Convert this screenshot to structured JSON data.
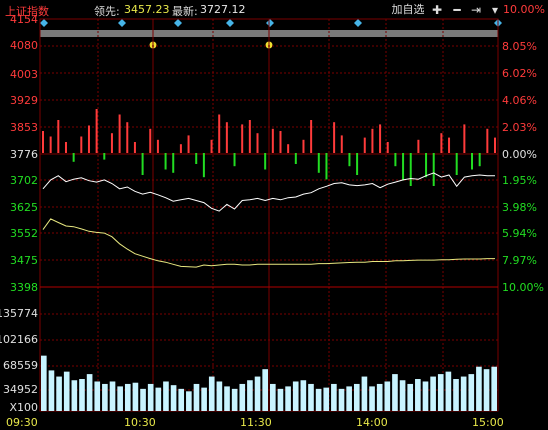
{
  "header": {
    "index_name": "上证指数",
    "lead_label": "领先:",
    "lead_value": "3457.23",
    "latest_label": "最新:",
    "latest_value": "3727.12",
    "select_label": "加自选",
    "zoom_in_icon": "plus-icon",
    "zoom_out_icon": "minus-icon",
    "last_icon": "skip-to-end-icon",
    "menu_icon": "dropdown-arrow-icon"
  },
  "price_axis": {
    "left": [
      "4154",
      "4080",
      "4003",
      "3929",
      "3853",
      "3776",
      "3702",
      "3625",
      "3552",
      "3475",
      "3398"
    ],
    "right": [
      "10.00%",
      "8.05%",
      "6.02%",
      "4.06%",
      "2.03%",
      "0.00%",
      "1.95%",
      "3.98%",
      "5.94%",
      "7.97%",
      "10.00%"
    ]
  },
  "volume_axis": [
    "135774",
    "102166",
    "68559",
    "34952",
    "X100"
  ],
  "time_axis": [
    "09:30",
    "10:30",
    "11:30",
    "14:00",
    "15:00"
  ],
  "colors": {
    "up": "#ff3b3b",
    "down": "#22dd22",
    "price_line": "#ffffff",
    "avg_line": "#e8e880",
    "grid": "#7a0000",
    "volume": "#c8f4ff"
  },
  "chart_data": {
    "type": "line",
    "y_range": [
      3398,
      4154
    ],
    "base_value": 3776,
    "price_series": [
      3675,
      3700,
      3712,
      3695,
      3702,
      3706,
      3698,
      3694,
      3700,
      3690,
      3675,
      3680,
      3668,
      3660,
      3665,
      3658,
      3650,
      3640,
      3644,
      3648,
      3642,
      3636,
      3620,
      3612,
      3631,
      3618,
      3642,
      3644,
      3648,
      3642,
      3648,
      3644,
      3650,
      3652,
      3660,
      3664,
      3675,
      3682,
      3690,
      3692,
      3686,
      3684,
      3686,
      3690,
      3678,
      3688,
      3694,
      3700,
      3704,
      3702,
      3712,
      3720,
      3708,
      3714,
      3682,
      3708,
      3712,
      3714,
      3712,
      3712
    ],
    "avg_series": [
      3560,
      3590,
      3580,
      3570,
      3568,
      3562,
      3555,
      3552,
      3550,
      3540,
      3520,
      3505,
      3492,
      3485,
      3478,
      3472,
      3468,
      3462,
      3456,
      3455,
      3454,
      3460,
      3458,
      3460,
      3462,
      3462,
      3460,
      3460,
      3462,
      3462,
      3462,
      3462,
      3462,
      3462,
      3462,
      3462,
      3464,
      3464,
      3465,
      3466,
      3467,
      3468,
      3468,
      3470,
      3470,
      3470,
      3472,
      3472,
      3473,
      3474,
      3474,
      3474,
      3475,
      3475,
      3476,
      3477,
      3477,
      3477,
      3478,
      3478
    ],
    "buy_sell_bars": [
      20,
      15,
      30,
      10,
      -8,
      15,
      25,
      40,
      -6,
      18,
      35,
      28,
      10,
      -20,
      22,
      12,
      -15,
      -18,
      8,
      16,
      -10,
      -22,
      12,
      35,
      28,
      -12,
      26,
      30,
      18,
      -15,
      22,
      20,
      8,
      -10,
      12,
      30,
      -18,
      -24,
      28,
      16,
      -12,
      -20,
      14,
      22,
      26,
      10,
      -12,
      -25,
      -30,
      12,
      -22,
      -30,
      18,
      14,
      -20,
      26,
      -15,
      -12,
      22,
      14
    ],
    "volume": [
      0.45,
      0.33,
      0.28,
      0.32,
      0.25,
      0.26,
      0.3,
      0.24,
      0.22,
      0.24,
      0.2,
      0.22,
      0.23,
      0.18,
      0.22,
      0.19,
      0.24,
      0.21,
      0.18,
      0.16,
      0.22,
      0.19,
      0.28,
      0.24,
      0.2,
      0.18,
      0.22,
      0.25,
      0.28,
      0.34,
      0.22,
      0.18,
      0.2,
      0.24,
      0.25,
      0.22,
      0.18,
      0.19,
      0.22,
      0.18,
      0.2,
      0.22,
      0.28,
      0.2,
      0.22,
      0.24,
      0.3,
      0.25,
      0.22,
      0.26,
      0.24,
      0.28,
      0.3,
      0.32,
      0.26,
      0.28,
      0.3,
      0.36,
      0.34,
      0.36
    ]
  }
}
